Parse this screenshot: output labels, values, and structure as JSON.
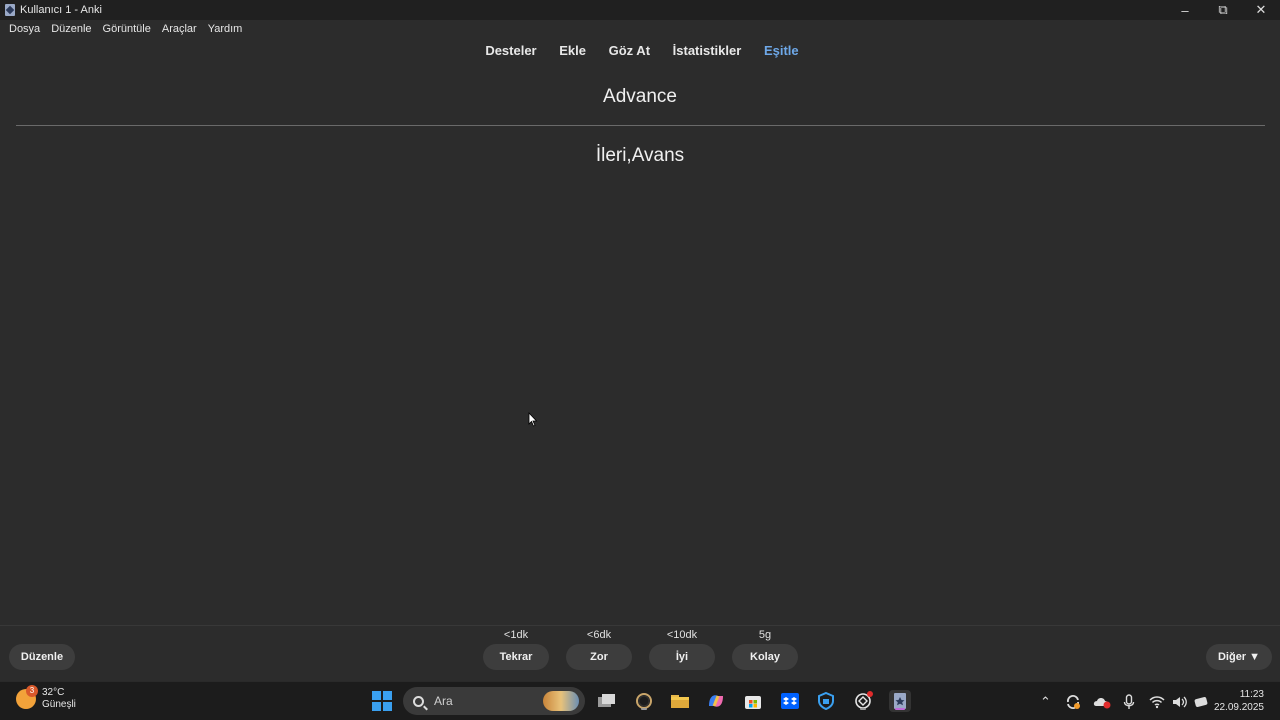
{
  "window": {
    "title": "Kullanıcı 1 - Anki"
  },
  "menu": [
    "Dosya",
    "Düzenle",
    "Görüntüle",
    "Araçlar",
    "Yardım"
  ],
  "nav": {
    "decks": "Desteler",
    "add": "Ekle",
    "browse": "Göz At",
    "stats": "İstatistikler",
    "sync": "Eşitle"
  },
  "card": {
    "front": "Advance",
    "back": "İleri,Avans"
  },
  "bottom": {
    "edit_label": "Düzenle",
    "more_label": "Diğer ▼",
    "answers": [
      {
        "label": "Tekrar",
        "interval": "<1dk"
      },
      {
        "label": "Zor",
        "interval": "<6dk"
      },
      {
        "label": "İyi",
        "interval": "<10dk"
      },
      {
        "label": "Kolay",
        "interval": "5g"
      }
    ]
  },
  "taskbar": {
    "weather_temp": "32°C",
    "weather_cond": "Güneşli",
    "search_placeholder": "Ara",
    "time": "11:23",
    "date": "22.09.2025"
  },
  "colors": {
    "background": "#2c2c2c",
    "accent_sync": "#6ea8e8",
    "button": "#3d3d3d"
  }
}
